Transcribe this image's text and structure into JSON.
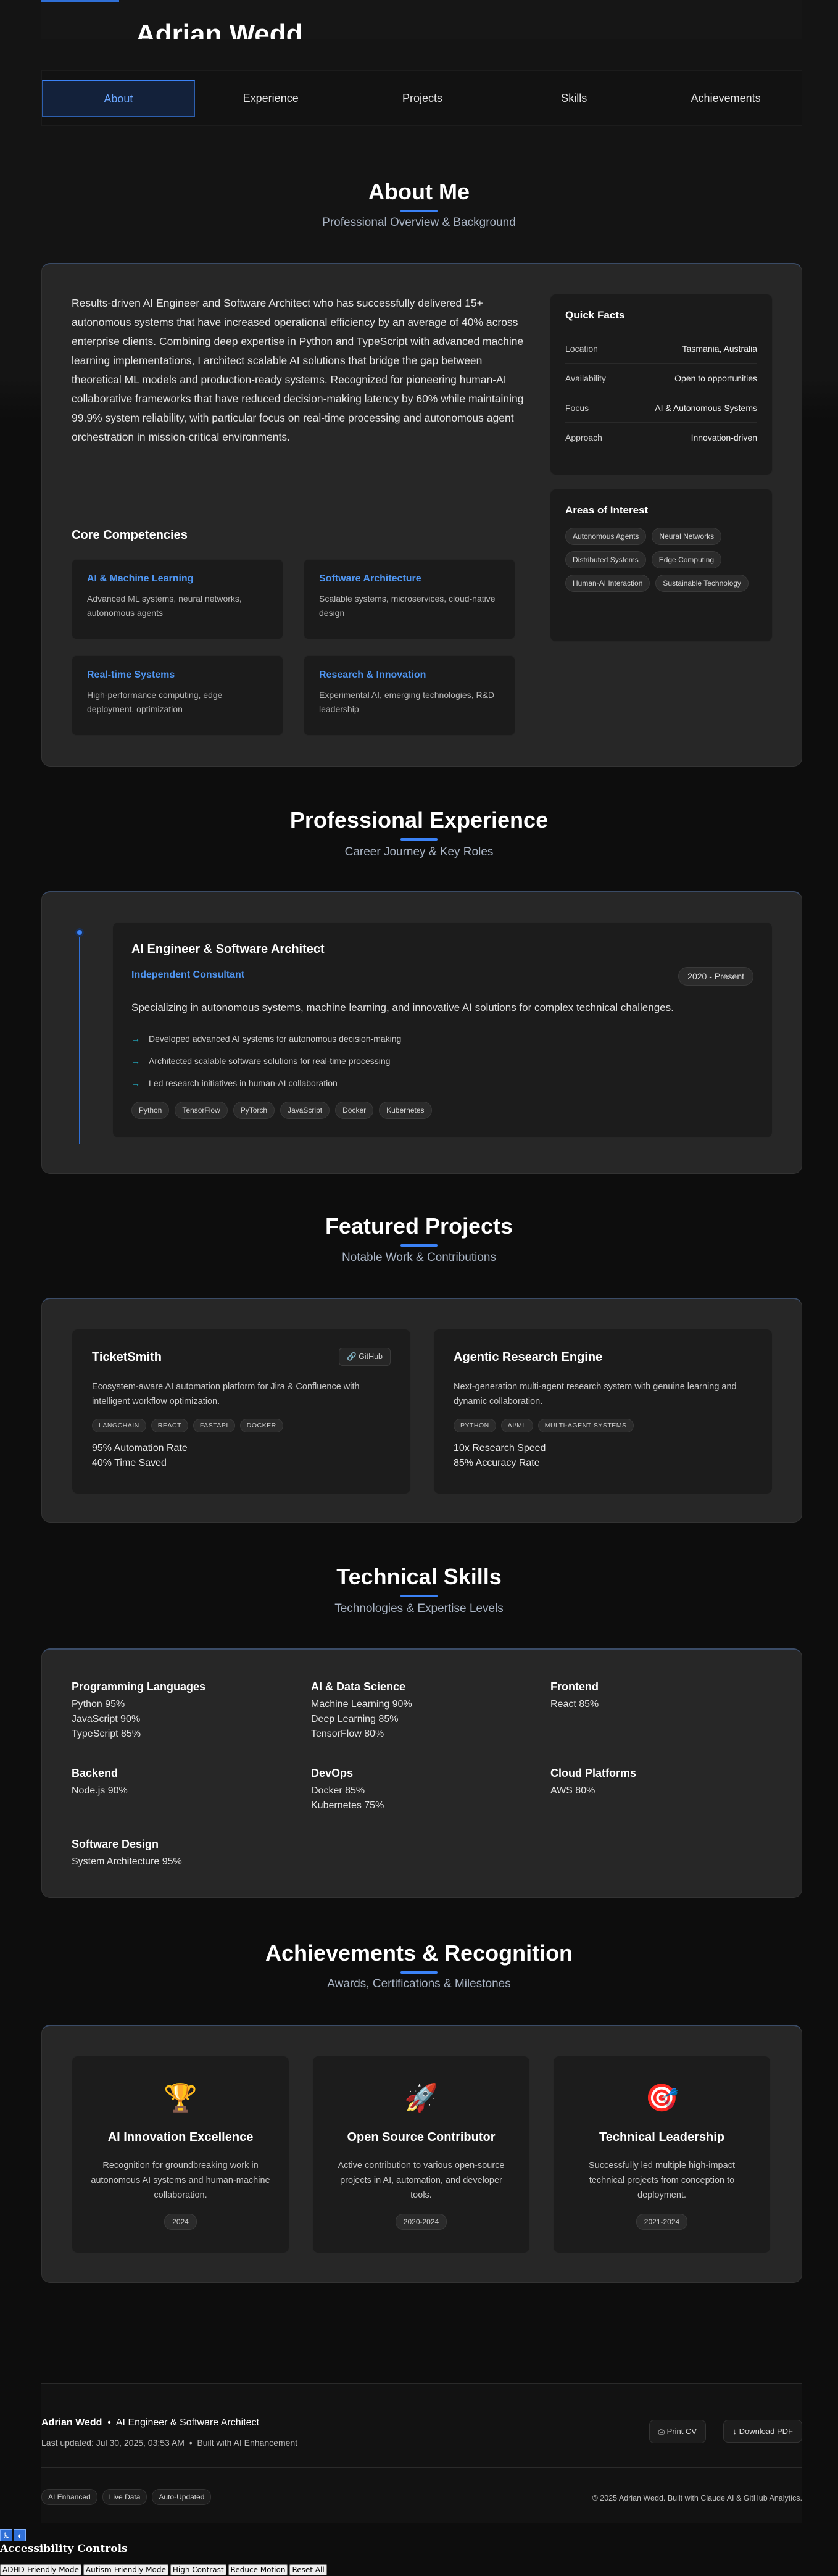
{
  "header": {
    "name": "Adrian Wedd"
  },
  "nav": [
    "About",
    "Experience",
    "Projects",
    "Skills",
    "Achievements"
  ],
  "about": {
    "title": "About Me",
    "subtitle": "Professional Overview & Background",
    "text": "Results-driven AI Engineer and Software Architect who has successfully delivered 15+ autonomous systems that have increased operational efficiency by an average of 40% across enterprise clients. Combining deep expertise in Python and TypeScript with advanced machine learning implementations, I architect scalable AI solutions that bridge the gap between theoretical ML models and production-ready systems. Recognized for pioneering human-AI collaborative frameworks that have reduced decision-making latency by 60% while maintaining 99.9% system reliability, with particular focus on real-time processing and autonomous agent orchestration in mission-critical environments.",
    "competencies_title": "Core Competencies",
    "competencies": [
      {
        "title": "AI & Machine Learning",
        "desc": "Advanced ML systems, neural networks, autonomous agents"
      },
      {
        "title": "Software Architecture",
        "desc": "Scalable systems, microservices, cloud-native design"
      },
      {
        "title": "Real-time Systems",
        "desc": "High-performance computing, edge deployment, optimization"
      },
      {
        "title": "Research & Innovation",
        "desc": "Experimental AI, emerging technologies, R&D leadership"
      }
    ],
    "quick_facts_title": "Quick Facts",
    "quick_facts": [
      {
        "k": "Location",
        "v": "Tasmania, Australia"
      },
      {
        "k": "Availability",
        "v": "Open to opportunities"
      },
      {
        "k": "Focus",
        "v": "AI & Autonomous Systems"
      },
      {
        "k": "Approach",
        "v": "Innovation-driven"
      }
    ],
    "interests_title": "Areas of Interest",
    "interests": [
      "Autonomous Agents",
      "Neural Networks",
      "Distributed Systems",
      "Edge Computing",
      "Human-AI Interaction",
      "Sustainable Technology"
    ]
  },
  "experience": {
    "title": "Professional Experience",
    "subtitle": "Career Journey & Key Roles",
    "role": "AI Engineer & Software Architect",
    "org": "Independent Consultant",
    "dates": "2020 - Present",
    "desc": "Specializing in autonomous systems, machine learning, and innovative AI solutions for complex technical challenges.",
    "bullets": [
      "Developed advanced AI systems for autonomous decision-making",
      "Architected scalable software solutions for real-time processing",
      "Led research initiatives in human-AI collaboration"
    ],
    "tags": [
      "Python",
      "TensorFlow",
      "PyTorch",
      "JavaScript",
      "Docker",
      "Kubernetes"
    ]
  },
  "projects": {
    "title": "Featured Projects",
    "subtitle": "Notable Work & Contributions",
    "items": [
      {
        "name": "TicketSmith",
        "link": "GitHub",
        "desc": "Ecosystem-aware AI automation platform for Jira & Confluence with intelligent workflow optimization.",
        "tags": [
          "LANGCHAIN",
          "REACT",
          "FASTAPI",
          "DOCKER"
        ],
        "metrics": [
          "95% Automation Rate",
          "40% Time Saved"
        ]
      },
      {
        "name": "Agentic Research Engine",
        "desc": "Next-generation multi-agent research system with genuine learning and dynamic collaboration.",
        "tags": [
          "PYTHON",
          "AI/ML",
          "MULTI-AGENT SYSTEMS"
        ],
        "metrics": [
          "10x Research Speed",
          "85% Accuracy Rate"
        ]
      }
    ]
  },
  "skills": {
    "title": "Technical Skills",
    "subtitle": "Technologies & Expertise Levels",
    "groups": [
      {
        "name": "Programming Languages",
        "items": [
          "Python 95%",
          "JavaScript 90%",
          "TypeScript 85%"
        ]
      },
      {
        "name": "AI & Data Science",
        "items": [
          "Machine Learning 90%",
          "Deep Learning 85%",
          "TensorFlow 80%"
        ]
      },
      {
        "name": "Frontend",
        "items": [
          "React 85%"
        ]
      },
      {
        "name": "Backend",
        "items": [
          "Node.js 90%"
        ]
      },
      {
        "name": "DevOps",
        "items": [
          "Docker 85%",
          "Kubernetes 75%"
        ]
      },
      {
        "name": "Cloud Platforms",
        "items": [
          "AWS 80%"
        ]
      },
      {
        "name": "Software Design",
        "items": [
          "System Architecture 95%"
        ]
      }
    ]
  },
  "achievements": {
    "title": "Achievements & Recognition",
    "subtitle": "Awards, Certifications & Milestones",
    "items": [
      {
        "icon": "🏆",
        "title": "AI Innovation Excellence",
        "desc": "Recognition for groundbreaking work in autonomous AI systems and human-machine collaboration.",
        "year": "2024"
      },
      {
        "icon": "🚀",
        "title": "Open Source Contributor",
        "desc": "Active contribution to various open-source projects in AI, automation, and developer tools.",
        "year": "2020-2024"
      },
      {
        "icon": "🎯",
        "title": "Technical Leadership",
        "desc": "Successfully led multiple high-impact technical projects from conception to deployment.",
        "year": "2021-2024"
      }
    ]
  },
  "footer": {
    "name": "Adrian Wedd",
    "role": "AI Engineer & Software Architect",
    "updated": "Last updated: Jul 30, 2025, 03:53 AM",
    "built": "Built with AI Enhancement",
    "print_label": "Print CV",
    "download_label": "Download PDF",
    "badges": [
      "AI Enhanced",
      "Live Data",
      "Auto-Updated"
    ],
    "copyright": "© 2025 Adrian Wedd. Built with Claude AI & GitHub Analytics."
  },
  "accessibility": {
    "title": "Accessibility Controls",
    "buttons": [
      "ADHD-Friendly Mode",
      "Autism-Friendly Mode",
      "High Contrast",
      "Reduce Motion",
      "Reset All"
    ]
  }
}
